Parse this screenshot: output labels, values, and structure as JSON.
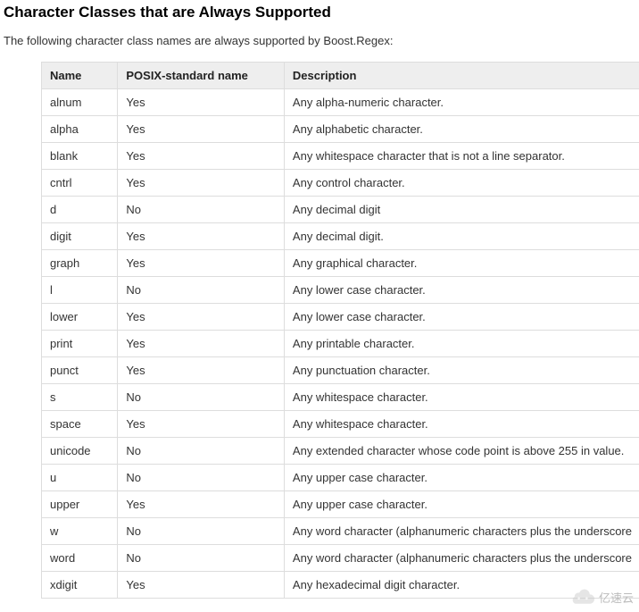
{
  "heading": "Character Classes that are Always Supported",
  "intro": "The following character class names are always supported by Boost.Regex:",
  "table": {
    "headers": [
      "Name",
      "POSIX-standard name",
      "Description"
    ],
    "rows": [
      {
        "name": "alnum",
        "posix": "Yes",
        "desc": "Any alpha-numeric character."
      },
      {
        "name": "alpha",
        "posix": "Yes",
        "desc": "Any alphabetic character."
      },
      {
        "name": "blank",
        "posix": "Yes",
        "desc": "Any whitespace character that is not a line separator."
      },
      {
        "name": "cntrl",
        "posix": "Yes",
        "desc": "Any control character."
      },
      {
        "name": "d",
        "posix": "No",
        "desc": "Any decimal digit"
      },
      {
        "name": "digit",
        "posix": "Yes",
        "desc": "Any decimal digit."
      },
      {
        "name": "graph",
        "posix": "Yes",
        "desc": "Any graphical character."
      },
      {
        "name": "l",
        "posix": "No",
        "desc": "Any lower case character."
      },
      {
        "name": "lower",
        "posix": "Yes",
        "desc": "Any lower case character."
      },
      {
        "name": "print",
        "posix": "Yes",
        "desc": "Any printable character."
      },
      {
        "name": "punct",
        "posix": "Yes",
        "desc": "Any punctuation character."
      },
      {
        "name": "s",
        "posix": "No",
        "desc": "Any whitespace character."
      },
      {
        "name": "space",
        "posix": "Yes",
        "desc": "Any whitespace character."
      },
      {
        "name": "unicode",
        "posix": "No",
        "desc": "Any extended character whose code point is above 255 in value."
      },
      {
        "name": "u",
        "posix": "No",
        "desc": "Any upper case character."
      },
      {
        "name": "upper",
        "posix": "Yes",
        "desc": "Any upper case character."
      },
      {
        "name": "w",
        "posix": "No",
        "desc": "Any word character (alphanumeric characters plus the underscore"
      },
      {
        "name": "word",
        "posix": "No",
        "desc": "Any word character (alphanumeric characters plus the underscore"
      },
      {
        "name": "xdigit",
        "posix": "Yes",
        "desc": "Any hexadecimal digit character."
      }
    ]
  },
  "watermark": "亿速云"
}
